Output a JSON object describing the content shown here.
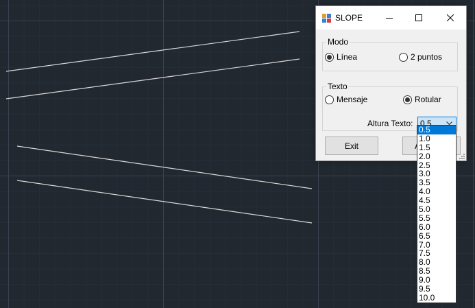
{
  "window": {
    "title": "SLOPE"
  },
  "modo": {
    "title": "Modo",
    "options": [
      {
        "label": "Línea",
        "checked": true
      },
      {
        "label": "2 puntos",
        "checked": false
      }
    ]
  },
  "texto": {
    "title": "Texto",
    "options": [
      {
        "label": "Mensaje",
        "checked": false
      },
      {
        "label": "Rotular",
        "checked": true
      }
    ],
    "altura_label": "Altura Texto:",
    "altura_value": "0.5"
  },
  "buttons": {
    "exit": "Exit",
    "aplicar_visible": "A"
  },
  "dropdown": {
    "items": [
      "0.5",
      "1.0",
      "1.5",
      "2.0",
      "2.5",
      "3.0",
      "3.5",
      "4.0",
      "4.5",
      "5.0",
      "5.5",
      "6.0",
      "6.5",
      "7.0",
      "7.5",
      "8.0",
      "8.5",
      "9.0",
      "9.5",
      "10.0"
    ],
    "selected_index": 0
  },
  "colors": {
    "canvas_background": "#212830",
    "grid_major": "#3a4250",
    "grid_minor": "#272e38",
    "line_color": "#d9d9d9",
    "selection": "#0078d7"
  }
}
